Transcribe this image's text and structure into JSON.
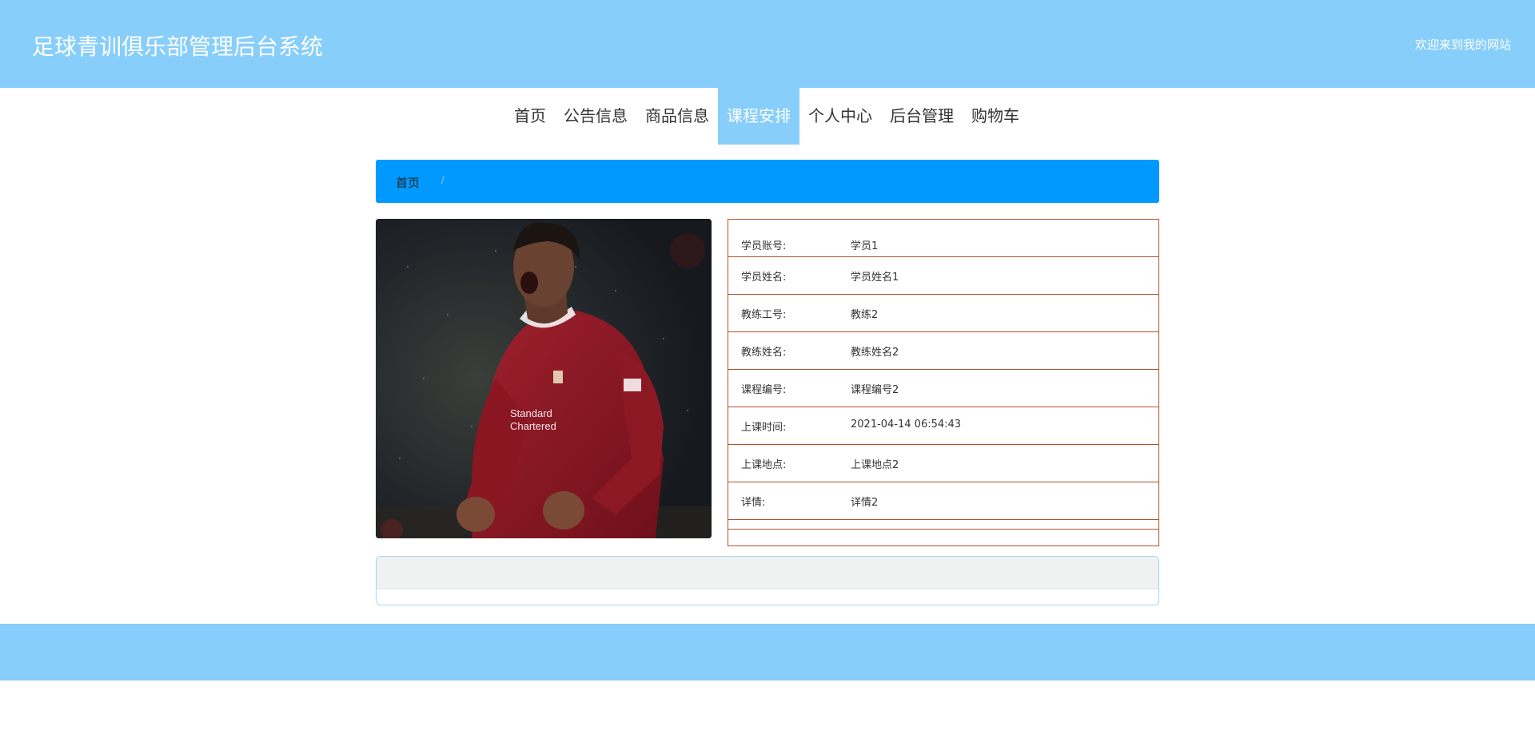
{
  "header": {
    "site_title": "足球青训俱乐部管理后台系统",
    "welcome": "欢迎来到我的网站"
  },
  "nav": [
    {
      "label": "首页",
      "active": false
    },
    {
      "label": "公告信息",
      "active": false
    },
    {
      "label": "商品信息",
      "active": false
    },
    {
      "label": "课程安排",
      "active": true
    },
    {
      "label": "个人中心",
      "active": false
    },
    {
      "label": "后台管理",
      "active": false
    },
    {
      "label": "购物车",
      "active": false
    }
  ],
  "breadcrumb": {
    "home": "首页",
    "separator": "/"
  },
  "image": {
    "alt": "football player celebrating"
  },
  "details": [
    {
      "label": "学员账号:",
      "value": "学员1"
    },
    {
      "label": "学员姓名:",
      "value": "学员姓名1"
    },
    {
      "label": "教练工号:",
      "value": "教练2"
    },
    {
      "label": "教练姓名:",
      "value": "教练姓名2"
    },
    {
      "label": "课程编号:",
      "value": "课程编号2"
    },
    {
      "label": "上课时间:",
      "value": "2021-04-14 06:54:43"
    },
    {
      "label": "上课地点:",
      "value": "上课地点2"
    },
    {
      "label": "详情:",
      "value": "详情2"
    }
  ],
  "colors": {
    "header_bg": "#87cefa",
    "breadcrumb_bg": "#0099ff",
    "detail_border": "#b5502a"
  }
}
